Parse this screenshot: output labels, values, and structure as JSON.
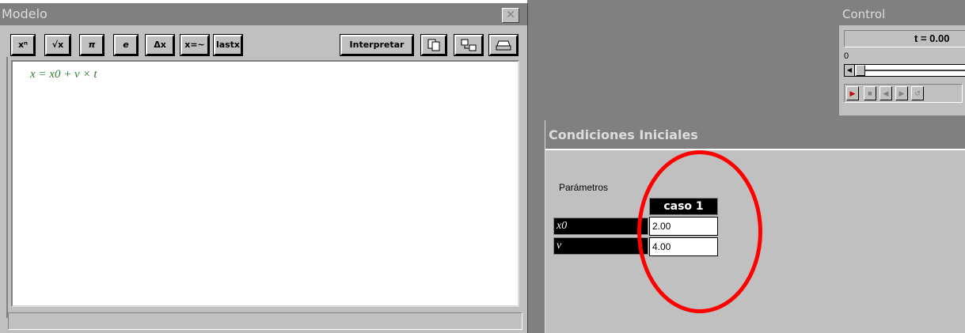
{
  "modelo": {
    "title": "Modelo",
    "close_label": "✕",
    "toolbar": {
      "power": "xⁿ",
      "sqrt": "√x",
      "pi": "π",
      "e": "e",
      "delta": "Δx",
      "approx": "x=~",
      "last": "lastx",
      "interpretar": "Interpretar"
    },
    "equation": "x = x0 + v × t"
  },
  "control": {
    "title": "Control",
    "time_readout": "t = 0.00",
    "slider_min": "0"
  },
  "condiciones": {
    "title": "Condiciones Iniciales",
    "params_label": "Parámetros",
    "case_header": "caso 1",
    "rows": [
      {
        "label": "x0",
        "value": "2.00"
      },
      {
        "label": "v",
        "value": "4.00"
      }
    ]
  },
  "colors": {
    "titlebar": "#808080",
    "window": "#c0c0c0",
    "equation": "#2e7d32",
    "annotation": "#ff0000"
  }
}
